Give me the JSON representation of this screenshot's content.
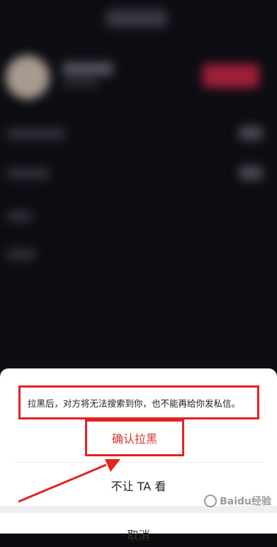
{
  "dialog": {
    "notice_text": "拉黑后，对方将无法搜索到你，也不能再给你发私信。",
    "confirm_label": "确认拉黑",
    "hide_from_label": "不让 TA 看",
    "cancel_label": "取消"
  },
  "annotation": {
    "highlight_color": "#e52222",
    "arrow_color": "#e52222"
  },
  "watermark": {
    "text": "Baidu经验"
  }
}
